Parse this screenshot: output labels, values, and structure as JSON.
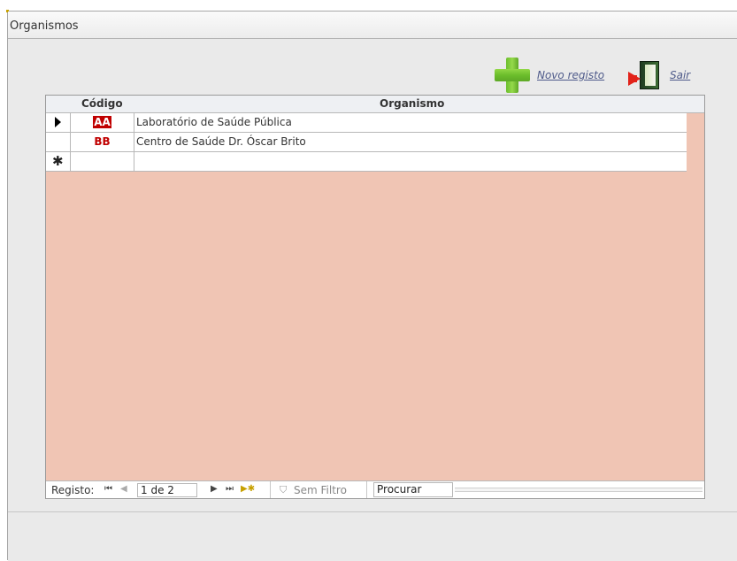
{
  "window": {
    "title": "Organismos"
  },
  "actions": {
    "new_label": "Novo registo",
    "exit_label": "Sair"
  },
  "table": {
    "columns": {
      "code": "Código",
      "organism": "Organismo"
    },
    "rows": [
      {
        "code": "AA",
        "organism": "Laboratório de Saúde Pública",
        "selected": true
      },
      {
        "code": "BB",
        "organism": "Centro de Saúde Dr. Óscar Brito",
        "selected": false
      }
    ],
    "new_row_marker": "✱"
  },
  "navigation": {
    "label": "Registo:",
    "record": "1 de 2",
    "filter_label": "Sem Filtro",
    "search_value": "Procurar"
  },
  "colors": {
    "datasheet_bg": "#f0c5b4",
    "code_text": "#c00000",
    "link": "#4e5a8a"
  }
}
